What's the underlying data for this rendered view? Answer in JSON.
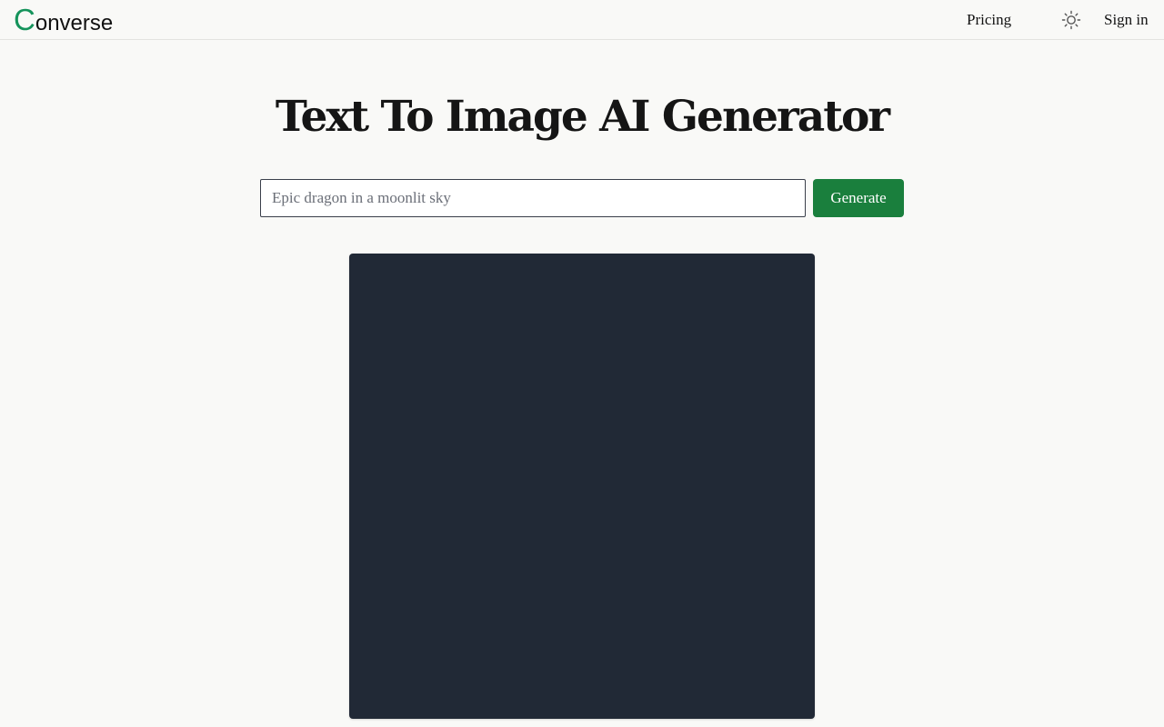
{
  "header": {
    "logo_initial": "C",
    "logo_rest": "onverse",
    "nav_pricing": "Pricing",
    "theme_toggle_icon": "sun-icon",
    "nav_signin": "Sign in"
  },
  "main": {
    "title": "Text To Image AI Generator",
    "prompt_placeholder": "Epic dragon in a moonlit sky",
    "prompt_value": "",
    "generate_label": "Generate"
  },
  "colors": {
    "brand_green": "#15935b",
    "button_green": "#1a7f3d",
    "image_panel": "#212936",
    "background": "#f9f9f7"
  }
}
